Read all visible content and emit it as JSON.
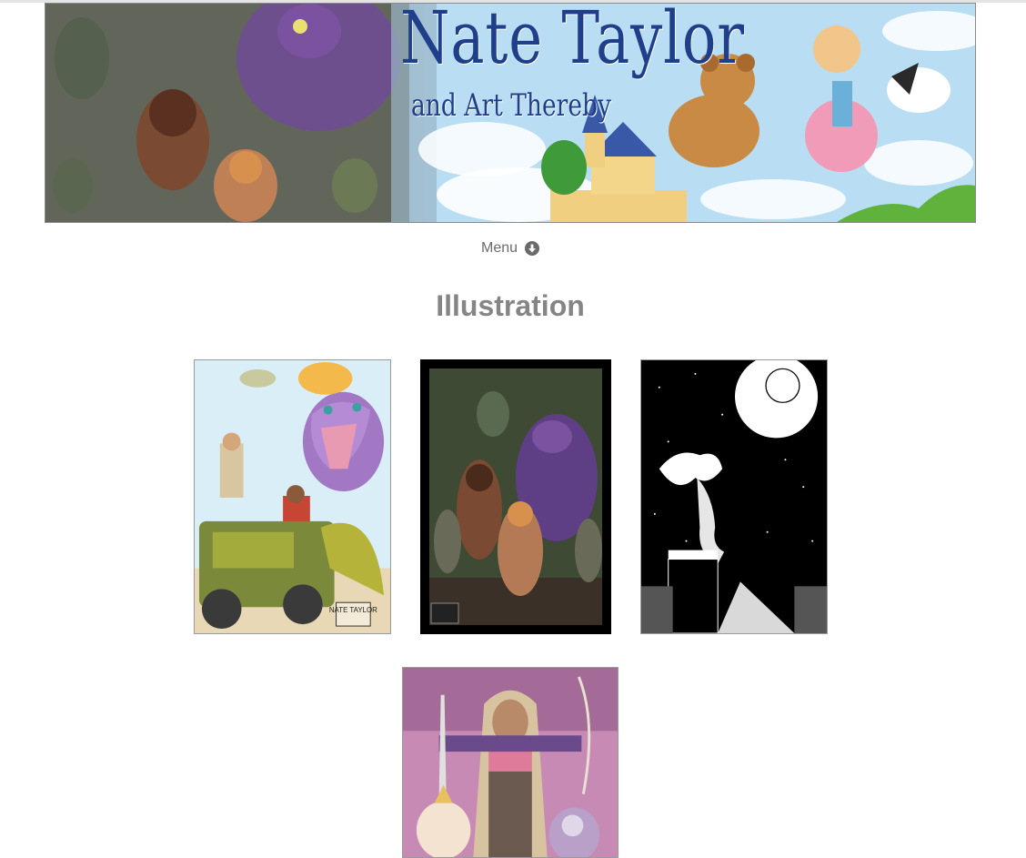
{
  "header": {
    "site_title": "Nate Taylor",
    "site_subtitle": "and Art Thereby"
  },
  "nav": {
    "menu_label": "Menu",
    "menu_icon": "circle-arrow-down-icon"
  },
  "main": {
    "page_title": "Illustration",
    "gallery": [
      {
        "name": "jeep-dinosaur-adventure",
        "signature": "NATE TAYLOR"
      },
      {
        "name": "fantasy-archer-battle",
        "signature": "NATE TAYLOR"
      },
      {
        "name": "moonlit-rooftop-figure"
      },
      {
        "name": "warrior-archer-group"
      }
    ]
  },
  "colors": {
    "title_text": "#858585",
    "menu_text": "#6a6a6a",
    "banner_title": "#1f3f8a"
  }
}
